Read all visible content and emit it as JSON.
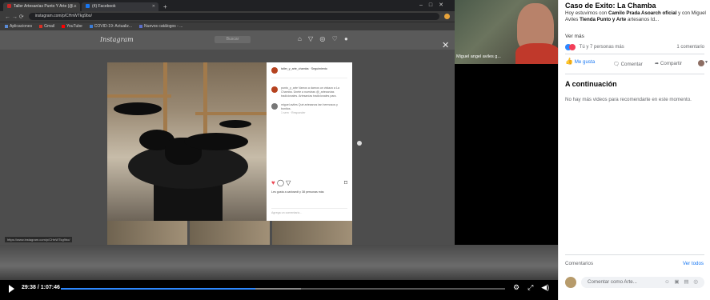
{
  "browser": {
    "tabs": [
      {
        "label": "Taller Artesanías Punto Y Arte (@...",
        "active": true
      },
      {
        "label": "(4) Facebook",
        "active": false
      }
    ],
    "url": "instagram.com/p/CHnWTkg9bo/",
    "bookmarks": [
      "Aplicaciones",
      "Gmail",
      "YouTube",
      "COVID-19: Actualiz...",
      "Nuevos catálogos - ..."
    ],
    "status_url": "https://www.instagram.com/p/CHnWTkg9bo/"
  },
  "instagram": {
    "logo": "Instagram",
    "search_placeholder": "Buscar",
    "post": {
      "author": "taller_y_arte_chamba · Seguimiento",
      "caption": "punto_y_arte Vamos a darnos un vistazo a La Chamba. Únete a nuestras @_artesanías tradicionales. Artesanías tradicionales para.",
      "comment": "miguel.aviles Qué artesanos tan hermosos y bonitos.",
      "comment_meta": "1 sem · Responder",
      "likes": "Les gusta a carlosedt y 38 personas más",
      "add_comment": "Agrega un comentario..."
    }
  },
  "webcam": {
    "name": "Miguel angel aviles g..."
  },
  "player": {
    "time": "29:38 / 1:07:46",
    "progress_fraction": 0.437,
    "buffer_fraction": 0.54
  },
  "panel": {
    "title": "Caso de Exito: La Chamba",
    "desc_prefix": "Hoy estuvimos con",
    "desc_name1": "Camilo Prada Asoarch oficial",
    "desc_mid": "y con Miguel Aviles",
    "desc_name2": "Tienda Punto y Arte",
    "desc_suffix": "artesanos Id...",
    "see_more": "Ver más",
    "reactions_text": "Tú y 7 personas más",
    "comments_count": "1 comentario",
    "like_label": "Me gusta",
    "comment_label": "Comentar",
    "share_label": "Compartir",
    "next_heading": "A continuación",
    "next_empty": "No hay más videos para recomendarte en este momento.",
    "comments_heading": "Comentarios",
    "see_all": "Ver todos",
    "comment_placeholder": "Comentar como Arte..."
  }
}
